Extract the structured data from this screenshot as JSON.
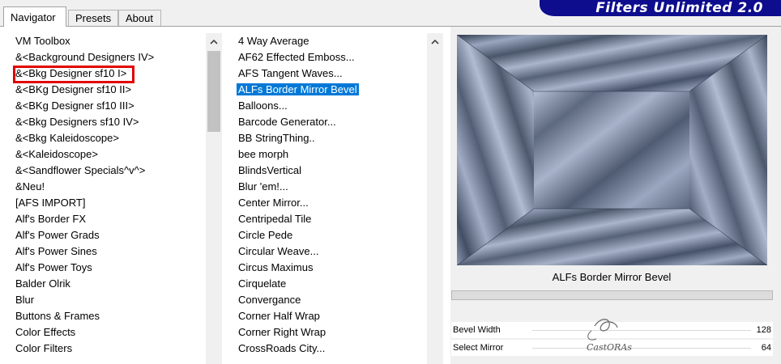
{
  "tabs": [
    {
      "label": "Navigator"
    },
    {
      "label": "Presets"
    },
    {
      "label": "About"
    }
  ],
  "brand": "Filters Unlimited 2.0",
  "categories": [
    "VM Toolbox",
    "&<Background Designers IV>",
    "&<Bkg Designer sf10 I>",
    "&<BKg Designer sf10 II>",
    "&<BKg Designer sf10 III>",
    "&<Bkg Designers sf10 IV>",
    "&<Bkg Kaleidoscope>",
    "&<Kaleidoscope>",
    "&<Sandflower Specials^v^>",
    "&Neu!",
    "[AFS IMPORT]",
    "Alf's Border FX",
    "Alf's Power Grads",
    "Alf's Power Sines",
    "Alf's Power Toys",
    "Balder Olrik",
    "Blur",
    "Buttons & Frames",
    "Color Effects",
    "Color Filters"
  ],
  "filters": [
    "4 Way Average",
    "AF62 Effected Emboss...",
    "AFS Tangent Waves...",
    "ALFs Border Mirror Bevel",
    "Balloons...",
    "Barcode Generator...",
    "BB StringThing..",
    "bee morph",
    "BlindsVertical",
    "Blur 'em!...",
    "Center Mirror...",
    "Centripedal Tile",
    "Circle Pede",
    "Circular Weave...",
    "Circus Maximus",
    "Cirquelate",
    "Convergance",
    "Corner Half Wrap",
    "Corner Right Wrap",
    "CrossRoads City..."
  ],
  "selected_filter": "ALFs Border Mirror Bevel",
  "highlighted_category": "&<Bkg Designer sf10 I>",
  "preview_filter_name": "ALFs Border Mirror Bevel",
  "params": [
    {
      "label": "Bevel Width",
      "value": "128"
    },
    {
      "label": "Select Mirror",
      "value": "64"
    }
  ],
  "watermark_text": "CastORAs",
  "colors": {
    "selection": "#0078d7",
    "brand_bg": "#0d0d8e",
    "highlight_box": "#e00000"
  },
  "icons": {
    "scroll_up": "chevron-up-icon"
  }
}
